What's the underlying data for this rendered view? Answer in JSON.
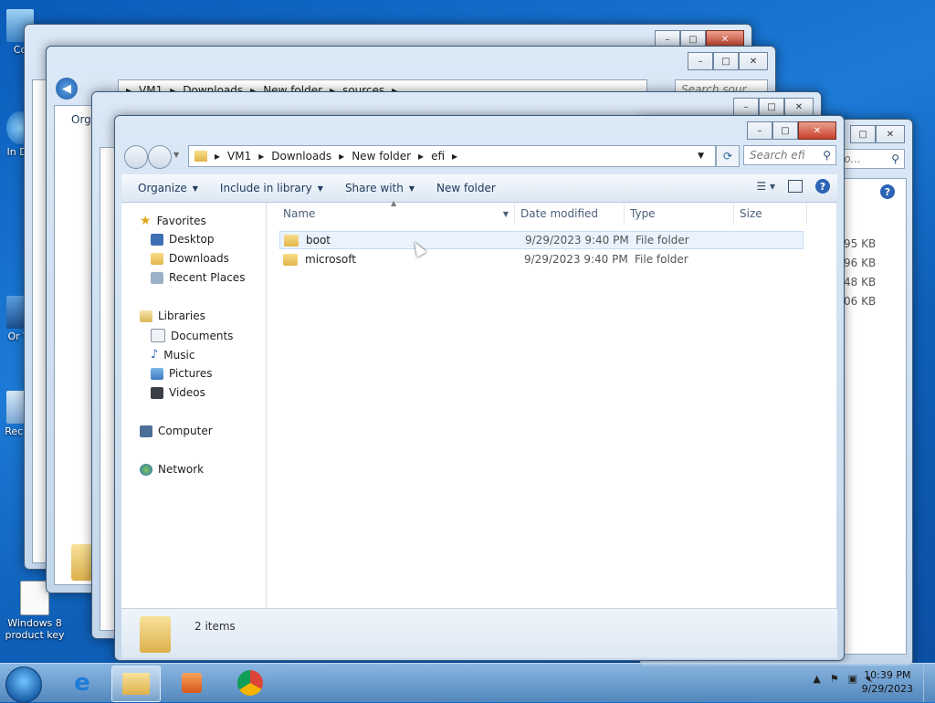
{
  "desktop": {
    "icons": [
      {
        "label": "Co"
      },
      {
        "label": "In Do"
      },
      {
        "label": "Or Vi"
      },
      {
        "label": "Rec Sl"
      },
      {
        "label": "Windows 8 product key"
      }
    ]
  },
  "back_window_2": {
    "path": [
      "VM1",
      "Downloads",
      "New folder",
      "sources"
    ],
    "search_placeholder": "Search sour...",
    "organize_partial": "Orga",
    "sizes": [
      "95 KB",
      "96 KB",
      "48 KB",
      "06 KB"
    ]
  },
  "back_window_3": {
    "search_placeholder": "ch Pro..."
  },
  "main_window": {
    "path": [
      "VM1",
      "Downloads",
      "New folder",
      "efi"
    ],
    "search_placeholder": "Search efi",
    "toolbar": {
      "organize": "Organize",
      "include_in_library": "Include in library",
      "share_with": "Share with",
      "new_folder": "New folder"
    },
    "nav": {
      "favorites": "Favorites",
      "desktop": "Desktop",
      "downloads": "Downloads",
      "recent_places": "Recent Places",
      "libraries": "Libraries",
      "documents": "Documents",
      "music": "Music",
      "pictures": "Pictures",
      "videos": "Videos",
      "computer": "Computer",
      "network": "Network"
    },
    "columns": {
      "name": "Name",
      "date_modified": "Date modified",
      "type": "Type",
      "size": "Size"
    },
    "files": [
      {
        "name": "boot",
        "date": "9/29/2023 9:40 PM",
        "type": "File folder",
        "size": ""
      },
      {
        "name": "microsoft",
        "date": "9/29/2023 9:40 PM",
        "type": "File folder",
        "size": ""
      }
    ],
    "status": {
      "count": "2 items"
    }
  },
  "taskbar": {
    "time": "10:39 PM",
    "date": "9/29/2023"
  },
  "colors": {
    "accent": "#1c7ad6",
    "selection": "#eaf3fd",
    "close": "#c8402a"
  }
}
